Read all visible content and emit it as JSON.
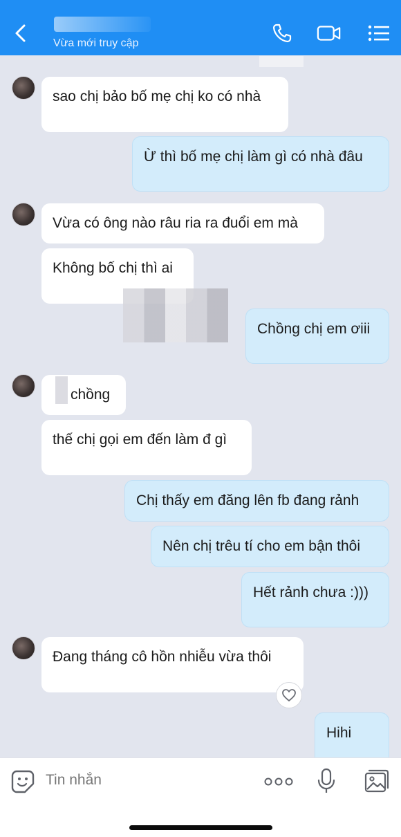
{
  "header": {
    "status": "Vừa mới truy cập",
    "icons": {
      "back": "chevron-left-icon",
      "call": "phone-icon",
      "video": "video-camera-icon",
      "menu": "list-menu-icon"
    },
    "background_color": "#1f8ef4"
  },
  "messages": [
    {
      "side": "in",
      "text": "sao chị bảo bố mẹ chị ko có nhà"
    },
    {
      "side": "out",
      "text": "Ừ thì bố mẹ chị làm gì có nhà đâu"
    },
    {
      "side": "in",
      "text": "Vừa có ông nào râu ria ra đuổi em mà"
    },
    {
      "side": "in",
      "text": "Không bố chị thì ai"
    },
    {
      "side": "out",
      "text": "Chồng chị em ơiii"
    },
    {
      "side": "in",
      "text": "chồng"
    },
    {
      "side": "in",
      "text": "thế chị gọi em đến làm đ gì"
    },
    {
      "side": "out",
      "text": "Chị thấy em đăng lên fb đang rảnh"
    },
    {
      "side": "out",
      "text": "Nên chị trêu tí cho em bận thôi"
    },
    {
      "side": "out",
      "text": "Hết rảnh chưa :)))"
    },
    {
      "side": "in",
      "text": "Đang tháng cô hồn nhiễu vừa thôi"
    },
    {
      "side": "out",
      "text": "Hihi"
    }
  ],
  "input": {
    "placeholder": "Tin nhắn",
    "icons": {
      "sticker": "sticker-smile-icon",
      "more": "more-dots-icon",
      "mic": "microphone-icon",
      "gallery": "image-gallery-icon"
    }
  },
  "reaction": {
    "icon": "heart-icon"
  },
  "colors": {
    "incoming_bubble": "#ffffff",
    "outgoing_bubble": "#d3ecfb",
    "chat_background": "#e2e5ee"
  }
}
